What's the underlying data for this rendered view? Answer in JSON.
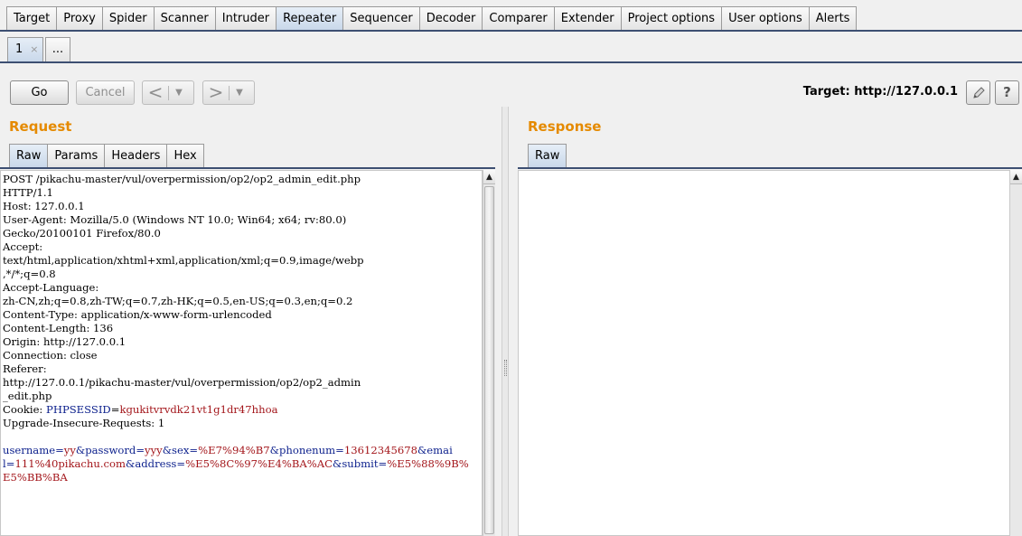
{
  "main_tabs": [
    "Target",
    "Proxy",
    "Spider",
    "Scanner",
    "Intruder",
    "Repeater",
    "Sequencer",
    "Decoder",
    "Comparer",
    "Extender",
    "Project options",
    "User options",
    "Alerts"
  ],
  "main_tabs_active": "Repeater",
  "sub_tabs": {
    "tab1": "1",
    "tab1_close": "×",
    "more": "..."
  },
  "toolbar": {
    "go": "Go",
    "cancel": "Cancel",
    "back_icon": "chevron-left-icon",
    "forward_icon": "chevron-right-icon",
    "target_label": "Target: http://127.0.0.1",
    "edit_icon": "pencil-icon",
    "help_label": "?"
  },
  "request": {
    "title": "Request",
    "tabs": [
      "Raw",
      "Params",
      "Headers",
      "Hex"
    ],
    "active_tab": "Raw",
    "lines": [
      "POST /pikachu-master/vul/overpermission/op2/op2_admin_edit.php",
      "HTTP/1.1",
      "Host: 127.0.0.1",
      "User-Agent: Mozilla/5.0 (Windows NT 10.0; Win64; x64; rv:80.0)",
      "Gecko/20100101 Firefox/80.0",
      "Accept:",
      "text/html,application/xhtml+xml,application/xml;q=0.9,image/webp",
      ",*/*;q=0.8",
      "Accept-Language:",
      "zh-CN,zh;q=0.8,zh-TW;q=0.7,zh-HK;q=0.5,en-US;q=0.3,en;q=0.2",
      "Content-Type: application/x-www-form-urlencoded",
      "Content-Length: 136",
      "Origin: http://127.0.0.1",
      "Connection: close",
      "Referer:",
      "http://127.0.0.1/pikachu-master/vul/overpermission/op2/op2_admin",
      "_edit.php"
    ],
    "cookie": {
      "label": "Cookie: ",
      "name": "PHPSESSID",
      "eq": "=",
      "value": "kgukitvrvdk21vt1g1dr47hhoa"
    },
    "upgrade": "Upgrade-Insecure-Requests: 1",
    "body_lines": [
      [
        [
          "k",
          "username"
        ],
        [
          "s",
          "="
        ],
        [
          "v",
          "yy"
        ],
        [
          "s",
          "&"
        ],
        [
          "k",
          "password"
        ],
        [
          "s",
          "="
        ],
        [
          "v",
          "yyy"
        ],
        [
          "s",
          "&"
        ],
        [
          "k",
          "sex"
        ],
        [
          "s",
          "="
        ],
        [
          "v",
          "%E7%94%B7"
        ],
        [
          "s",
          "&"
        ],
        [
          "k",
          "phonenum"
        ],
        [
          "s",
          "="
        ],
        [
          "v",
          "13612345678"
        ],
        [
          "s",
          "&"
        ],
        [
          "k",
          "emai"
        ]
      ],
      [
        [
          "k",
          "l"
        ],
        [
          "s",
          "="
        ],
        [
          "v",
          "111%40pikachu.com"
        ],
        [
          "s",
          "&"
        ],
        [
          "k",
          "address"
        ],
        [
          "s",
          "="
        ],
        [
          "v",
          "%E5%8C%97%E4%BA%AC"
        ],
        [
          "s",
          "&"
        ],
        [
          "k",
          "submit"
        ],
        [
          "s",
          "="
        ],
        [
          "v",
          "%E5%88%9B%"
        ]
      ],
      [
        [
          "v",
          "E5%BB%BA"
        ]
      ]
    ]
  },
  "response": {
    "title": "Response",
    "tabs": [
      "Raw"
    ],
    "active_tab": "Raw"
  },
  "colors": {
    "accent_title": "#e58a00",
    "param_name": "#0b1f8c",
    "param_value": "#a3151a",
    "tab_line": "#3d4f72"
  }
}
